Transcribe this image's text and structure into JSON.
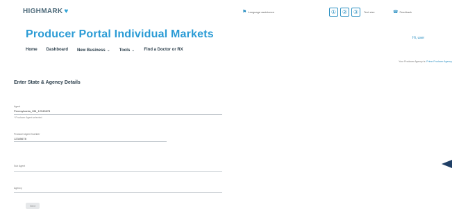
{
  "header": {
    "logo_text": "HIGHMARK",
    "logo_mark": "♥",
    "language_label": "Language assistance",
    "accessibility": [
      "①",
      "②",
      "③"
    ],
    "accessibility_text": "Text size",
    "feedback_label": "Feedback"
  },
  "portal_title": "Producer Portal Individual Markets",
  "user_menu": "Hi, user",
  "nav": [
    {
      "label": "Home",
      "has_menu": false
    },
    {
      "label": "Dashboard",
      "has_menu": false
    },
    {
      "label": "New Business",
      "has_menu": true
    },
    {
      "label": "Tools",
      "has_menu": true
    },
    {
      "label": "Find a Doctor or RX",
      "has_menu": false
    }
  ],
  "notice": {
    "text": "Your Producer Agency is:",
    "link": "Prime Producer Agency"
  },
  "section_title": "Enter State & Agency Details",
  "form": {
    "agent": {
      "label": "Agent",
      "value": "Pennsylvania_HM_12345678",
      "hint": "* Producer Agent selected"
    },
    "number": {
      "label": "Producer Agent Number",
      "value": "12345678"
    },
    "entry": {
      "label": "Sub Agent"
    },
    "last": {
      "label": "Agency"
    },
    "submit_label": "Next"
  },
  "colors": {
    "brand": "#2a9bd5",
    "nav_text": "#2a3d4a",
    "pointer": "#1f3f66"
  }
}
